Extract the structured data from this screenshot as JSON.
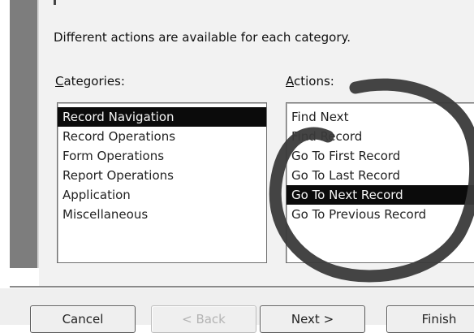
{
  "dialog": {
    "instruction": "Different actions are available for each category."
  },
  "categories": {
    "label_accel": "C",
    "label_rest": "ategories:",
    "items": [
      {
        "label": "Record Navigation",
        "selected": true
      },
      {
        "label": "Record Operations",
        "selected": false
      },
      {
        "label": "Form Operations",
        "selected": false
      },
      {
        "label": "Report Operations",
        "selected": false
      },
      {
        "label": "Application",
        "selected": false
      },
      {
        "label": "Miscellaneous",
        "selected": false
      }
    ]
  },
  "actions": {
    "label_accel": "A",
    "label_rest": "ctions:",
    "items": [
      {
        "label": "Find Next",
        "selected": false
      },
      {
        "label": "Find Record",
        "selected": false
      },
      {
        "label": "Go To First Record",
        "selected": false
      },
      {
        "label": "Go To Last Record",
        "selected": false
      },
      {
        "label": "Go To Next Record",
        "selected": true
      },
      {
        "label": "Go To Previous Record",
        "selected": false
      }
    ]
  },
  "buttons": {
    "cancel": "Cancel",
    "back": "< Back",
    "next": "Next >",
    "finish": "Finish"
  },
  "annotation": {
    "color": "#3a3a3a"
  }
}
